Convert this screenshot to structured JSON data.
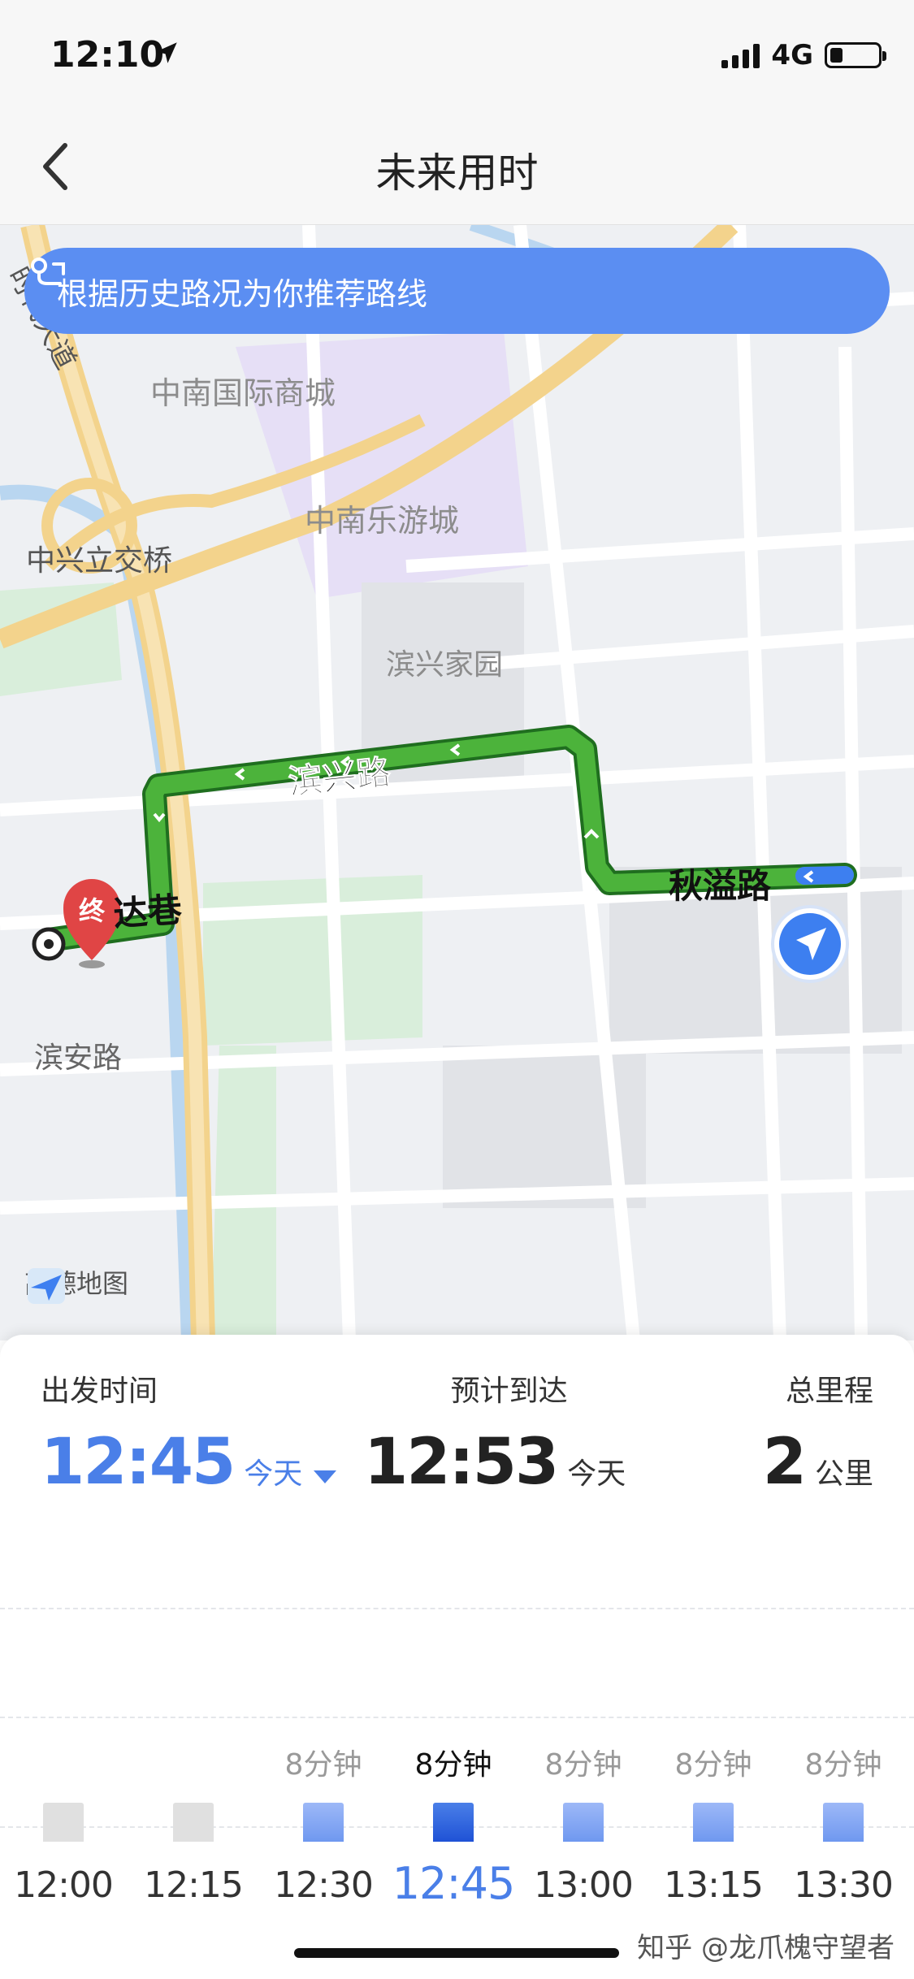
{
  "status_bar": {
    "time": "12:10",
    "network": "4G",
    "battery_percent": 25
  },
  "nav": {
    "title": "未来用时"
  },
  "map": {
    "banner_text": "根据历史路况为你推荐路线",
    "labels": {
      "shidai": "时代大道",
      "zhongnan_mall": "中南国际商城",
      "zhongnan_park": "中南乐游城",
      "zhongxing_bridge": "中兴立交桥",
      "binxing_garden": "滨兴家园",
      "binxing_road": "滨兴路",
      "qiuyi_road": "秋溢路",
      "da_lane": "达巷",
      "binan_road": "滨安路"
    },
    "end_marker": "终",
    "logo_text": "高德地图",
    "colors": {
      "route": "#3fa83f",
      "route_start": "#3d7ff0",
      "banner": "#5b8ef2"
    }
  },
  "summary": {
    "depart_label": "出发时间",
    "depart_time": "12:45",
    "depart_day": "今天",
    "arrive_label": "预计到达",
    "arrive_time": "12:53",
    "arrive_day": "今天",
    "distance_label": "总里程",
    "distance_value": "2",
    "distance_unit": "公里"
  },
  "timeline": {
    "selected": "12:45",
    "slots": [
      {
        "time": "12:00",
        "duration": "",
        "minutes": 8,
        "status": "past"
      },
      {
        "time": "12:15",
        "duration": "",
        "minutes": 8,
        "status": "past"
      },
      {
        "time": "12:30",
        "duration": "8分钟",
        "minutes": 8,
        "status": "future"
      },
      {
        "time": "12:45",
        "duration": "8分钟",
        "minutes": 8,
        "status": "selected"
      },
      {
        "time": "13:00",
        "duration": "8分钟",
        "minutes": 8,
        "status": "future"
      },
      {
        "time": "13:15",
        "duration": "8分钟",
        "minutes": 8,
        "status": "future"
      },
      {
        "time": "13:30",
        "duration": "8分钟",
        "minutes": 8,
        "status": "future"
      }
    ]
  },
  "watermark": "知乎 @龙爪槐守望者"
}
